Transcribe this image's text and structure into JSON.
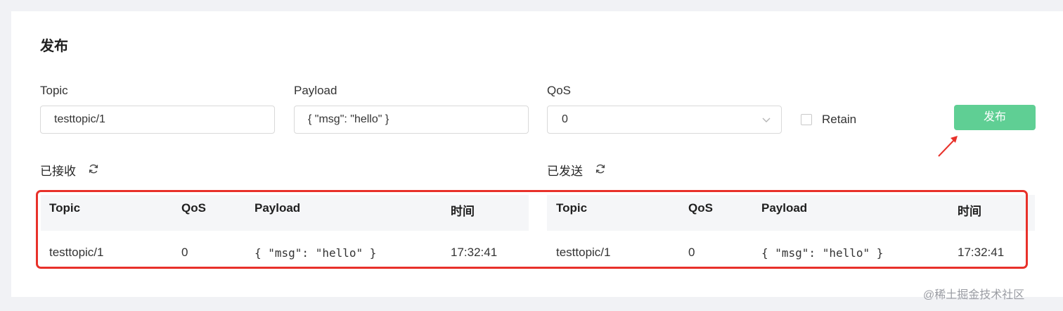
{
  "publish": {
    "title": "发布",
    "topic_label": "Topic",
    "topic_value": "testtopic/1",
    "payload_label": "Payload",
    "payload_value": "{ \"msg\": \"hello\" }",
    "qos_label": "QoS",
    "qos_value": "0",
    "retain_label": "Retain",
    "retain_checked": false,
    "button_label": "发布",
    "button_color": "#5fcf94"
  },
  "received": {
    "label": "已接收",
    "columns": [
      "Topic",
      "QoS",
      "Payload",
      "时间"
    ],
    "rows": [
      {
        "topic": "testtopic/1",
        "qos": "0",
        "payload": "{ \"msg\": \"hello\" }",
        "time": "17:32:41"
      }
    ]
  },
  "sent": {
    "label": "已发送",
    "columns": [
      "Topic",
      "QoS",
      "Payload",
      "时间"
    ],
    "rows": [
      {
        "topic": "testtopic/1",
        "qos": "0",
        "payload": "{ \"msg\": \"hello\" }",
        "time": "17:32:41"
      }
    ]
  },
  "annotation_color": "#e8312a",
  "watermark": "@稀土掘金技术社区"
}
